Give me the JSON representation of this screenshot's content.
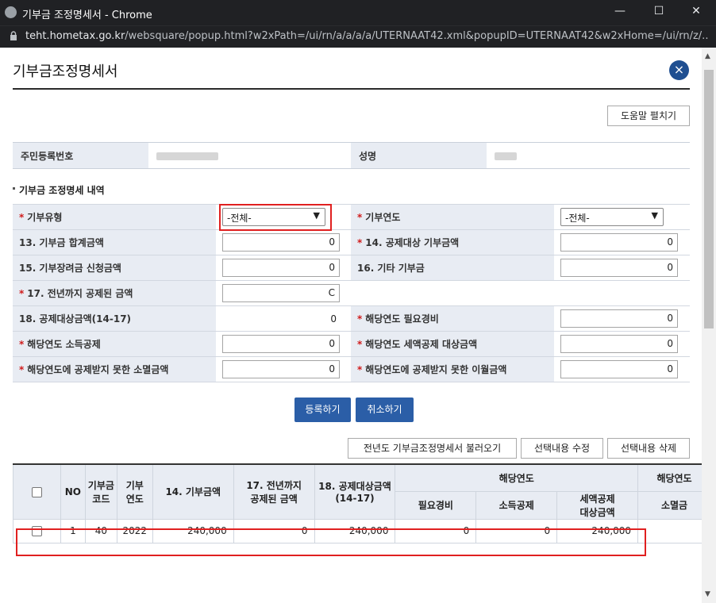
{
  "window": {
    "title": "기부금 조정명세서 - Chrome",
    "minimize": "—",
    "maximize": "☐",
    "close": "✕"
  },
  "address": {
    "host": "teht.hometax.go.kr",
    "path": "/websquare/popup.html?w2xPath=/ui/rn/a/a/a/a/UTERNAAT42.xml&popupID=UTERNAAT42&w2xHome=/ui/rn/z/..."
  },
  "page": {
    "title": "기부금조정명세서",
    "close_glyph": "×",
    "help_button": "도움말 펼치기"
  },
  "person": {
    "ssn_label": "주민등록번호",
    "name_label": "성명"
  },
  "section": {
    "title": "기부금 조정명세 내역"
  },
  "form": {
    "type_label": "기부유형",
    "type_value": "-전체-",
    "year_label": "기부연도",
    "year_value": "-전체-",
    "f13_label": "13. 기부금 합계금액",
    "f13_value": "0",
    "f14_label": "14. 공제대상 기부금액",
    "f14_value": "0",
    "f15_label": "15. 기부장려금 신청금액",
    "f15_value": "0",
    "f16_label": "16. 기타 기부금",
    "f16_value": "0",
    "f17_label": "17. 전년까지 공제된 금액",
    "f17_value": "C",
    "f18_label": "18. 공제대상금액(14-17)",
    "f18_value": "0",
    "need_label": "해당연도 필요경비",
    "need_value": "0",
    "income_label": "해당연도 소득공제",
    "income_value": "0",
    "tax_label": "해당연도 세액공제 대상금액",
    "tax_value": "0",
    "extinct_label": "해당연도에 공제받지 못한 소멸금액",
    "extinct_value": "0",
    "carry_label": "해당연도에 공제받지 못한 이월금액",
    "carry_value": "0"
  },
  "actions": {
    "register": "등록하기",
    "cancel": "취소하기",
    "load_prev": "전년도 기부금조정명세서 불러오기",
    "edit": "선택내용 수정",
    "delete": "선택내용 삭제"
  },
  "grid": {
    "headers": {
      "no": "NO",
      "code": "기부금\n코드",
      "year": "기부\n연도",
      "amount": "14. 기부금액",
      "deducted": "17. 전년까지\n공제된 금액",
      "target": "18. 공제대상금액\n(14-17)",
      "current_year": "해당연도",
      "next_group": "해당연도",
      "need": "필요경비",
      "income": "소득공제",
      "tax": "세액공제\n대상금액",
      "extinct": "소멸금"
    },
    "rows": [
      {
        "no": "1",
        "code": "40",
        "year": "2022",
        "amount": "240,000",
        "deducted": "0",
        "target": "240,000",
        "need": "0",
        "income": "0",
        "tax": "240,000",
        "extinct": ""
      }
    ]
  }
}
